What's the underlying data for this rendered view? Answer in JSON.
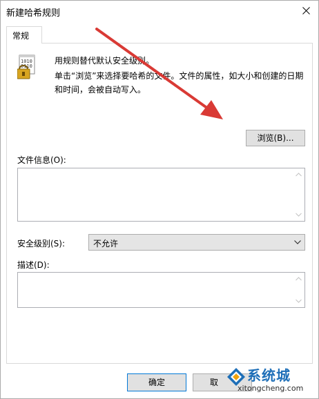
{
  "window": {
    "title": "新建哈希规则"
  },
  "tabs": [
    {
      "label": "常规"
    }
  ],
  "general": {
    "heading": "用规则替代默认安全级别。",
    "instructions": "单击“浏览”来选择要哈希的文件。文件的属性，如大小和创建的日期和时间，会被自动写入。",
    "browse_label": "浏览(B)...",
    "file_info_label": "文件信息(O):",
    "file_info_value": "",
    "security_level_label": "安全级别(S):",
    "security_level_value": "不允许",
    "description_label": "描述(D):",
    "description_value": ""
  },
  "buttons": {
    "ok_label": "确定",
    "cancel_label": "取"
  },
  "watermark": {
    "brand_cn": "系统城",
    "brand_en": "xitongcheng.com"
  },
  "colors": {
    "annotation_arrow": "#d93a35",
    "focus_border": "#0078d7",
    "watermark_blue": "#1e6fb8"
  },
  "icons": {
    "certificate": "certificate-binary-lock-icon",
    "close": "close-icon",
    "dropdown": "chevron-down-icon"
  }
}
